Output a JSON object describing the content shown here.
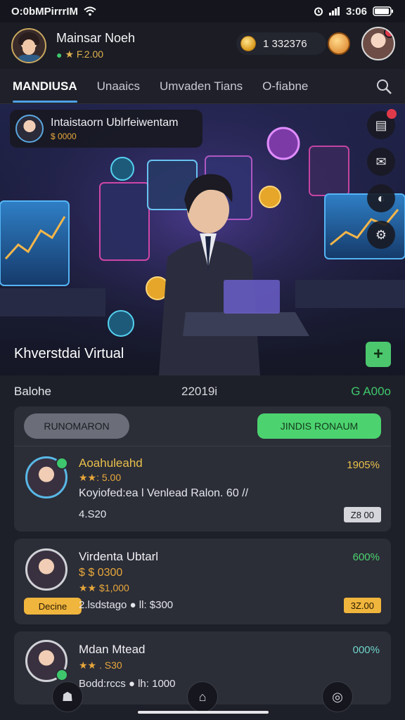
{
  "status_bar": {
    "carrier": "O:0bMPirrrIM",
    "time": "3:06"
  },
  "profile": {
    "name": "Mainsar Noeh",
    "rating": "★ F.2.00",
    "coins": "1 332376"
  },
  "tabs": [
    {
      "label": "MANDIUSA",
      "active": true
    },
    {
      "label": "Unaaics",
      "active": false
    },
    {
      "label": "Umvaden Tians",
      "active": false
    },
    {
      "label": "O-fiabne",
      "active": false
    }
  ],
  "hero": {
    "badge_title": "Intaistaorn Ublrfeiwentam",
    "badge_value": "$ 0000",
    "caption": "Khverstdai Virtual"
  },
  "summary": {
    "label": "Balohe",
    "middle": "22019i",
    "right": "G A00o"
  },
  "filters": {
    "left": "RUNOMARON",
    "right": "JINDIS RONAUM"
  },
  "list": [
    {
      "name": "Aoahuleahd",
      "stars": "★★: 5.00",
      "percent": "1905%",
      "description": "Koyiofed:ea l Venlead Ralon. 60  //",
      "bottom": "4.S20",
      "tag": "Z8 00"
    },
    {
      "name": "Virdenta Ubtarl",
      "price": "$ $ 0300",
      "stars": "★★ $1,000",
      "percent": "600%",
      "badge": "Decine",
      "bottom": "2.lsdstago  ● ll: $300",
      "tag": "3Z.00"
    },
    {
      "name": "Mdan Mtead",
      "stars": "★★ . S30",
      "percent": "000%",
      "bottom": "Bodd:rccs  ● lh: 1000"
    }
  ],
  "colors": {
    "accent_blue": "#4ea0e8",
    "accent_green": "#4cd36f",
    "gold": "#e8a83a",
    "background": "#1e2029",
    "card": "#2b2d37"
  },
  "icons": {
    "wifi": "wifi-icon",
    "search": "search-icon",
    "gift": "gift-icon",
    "add": "plus-icon"
  }
}
